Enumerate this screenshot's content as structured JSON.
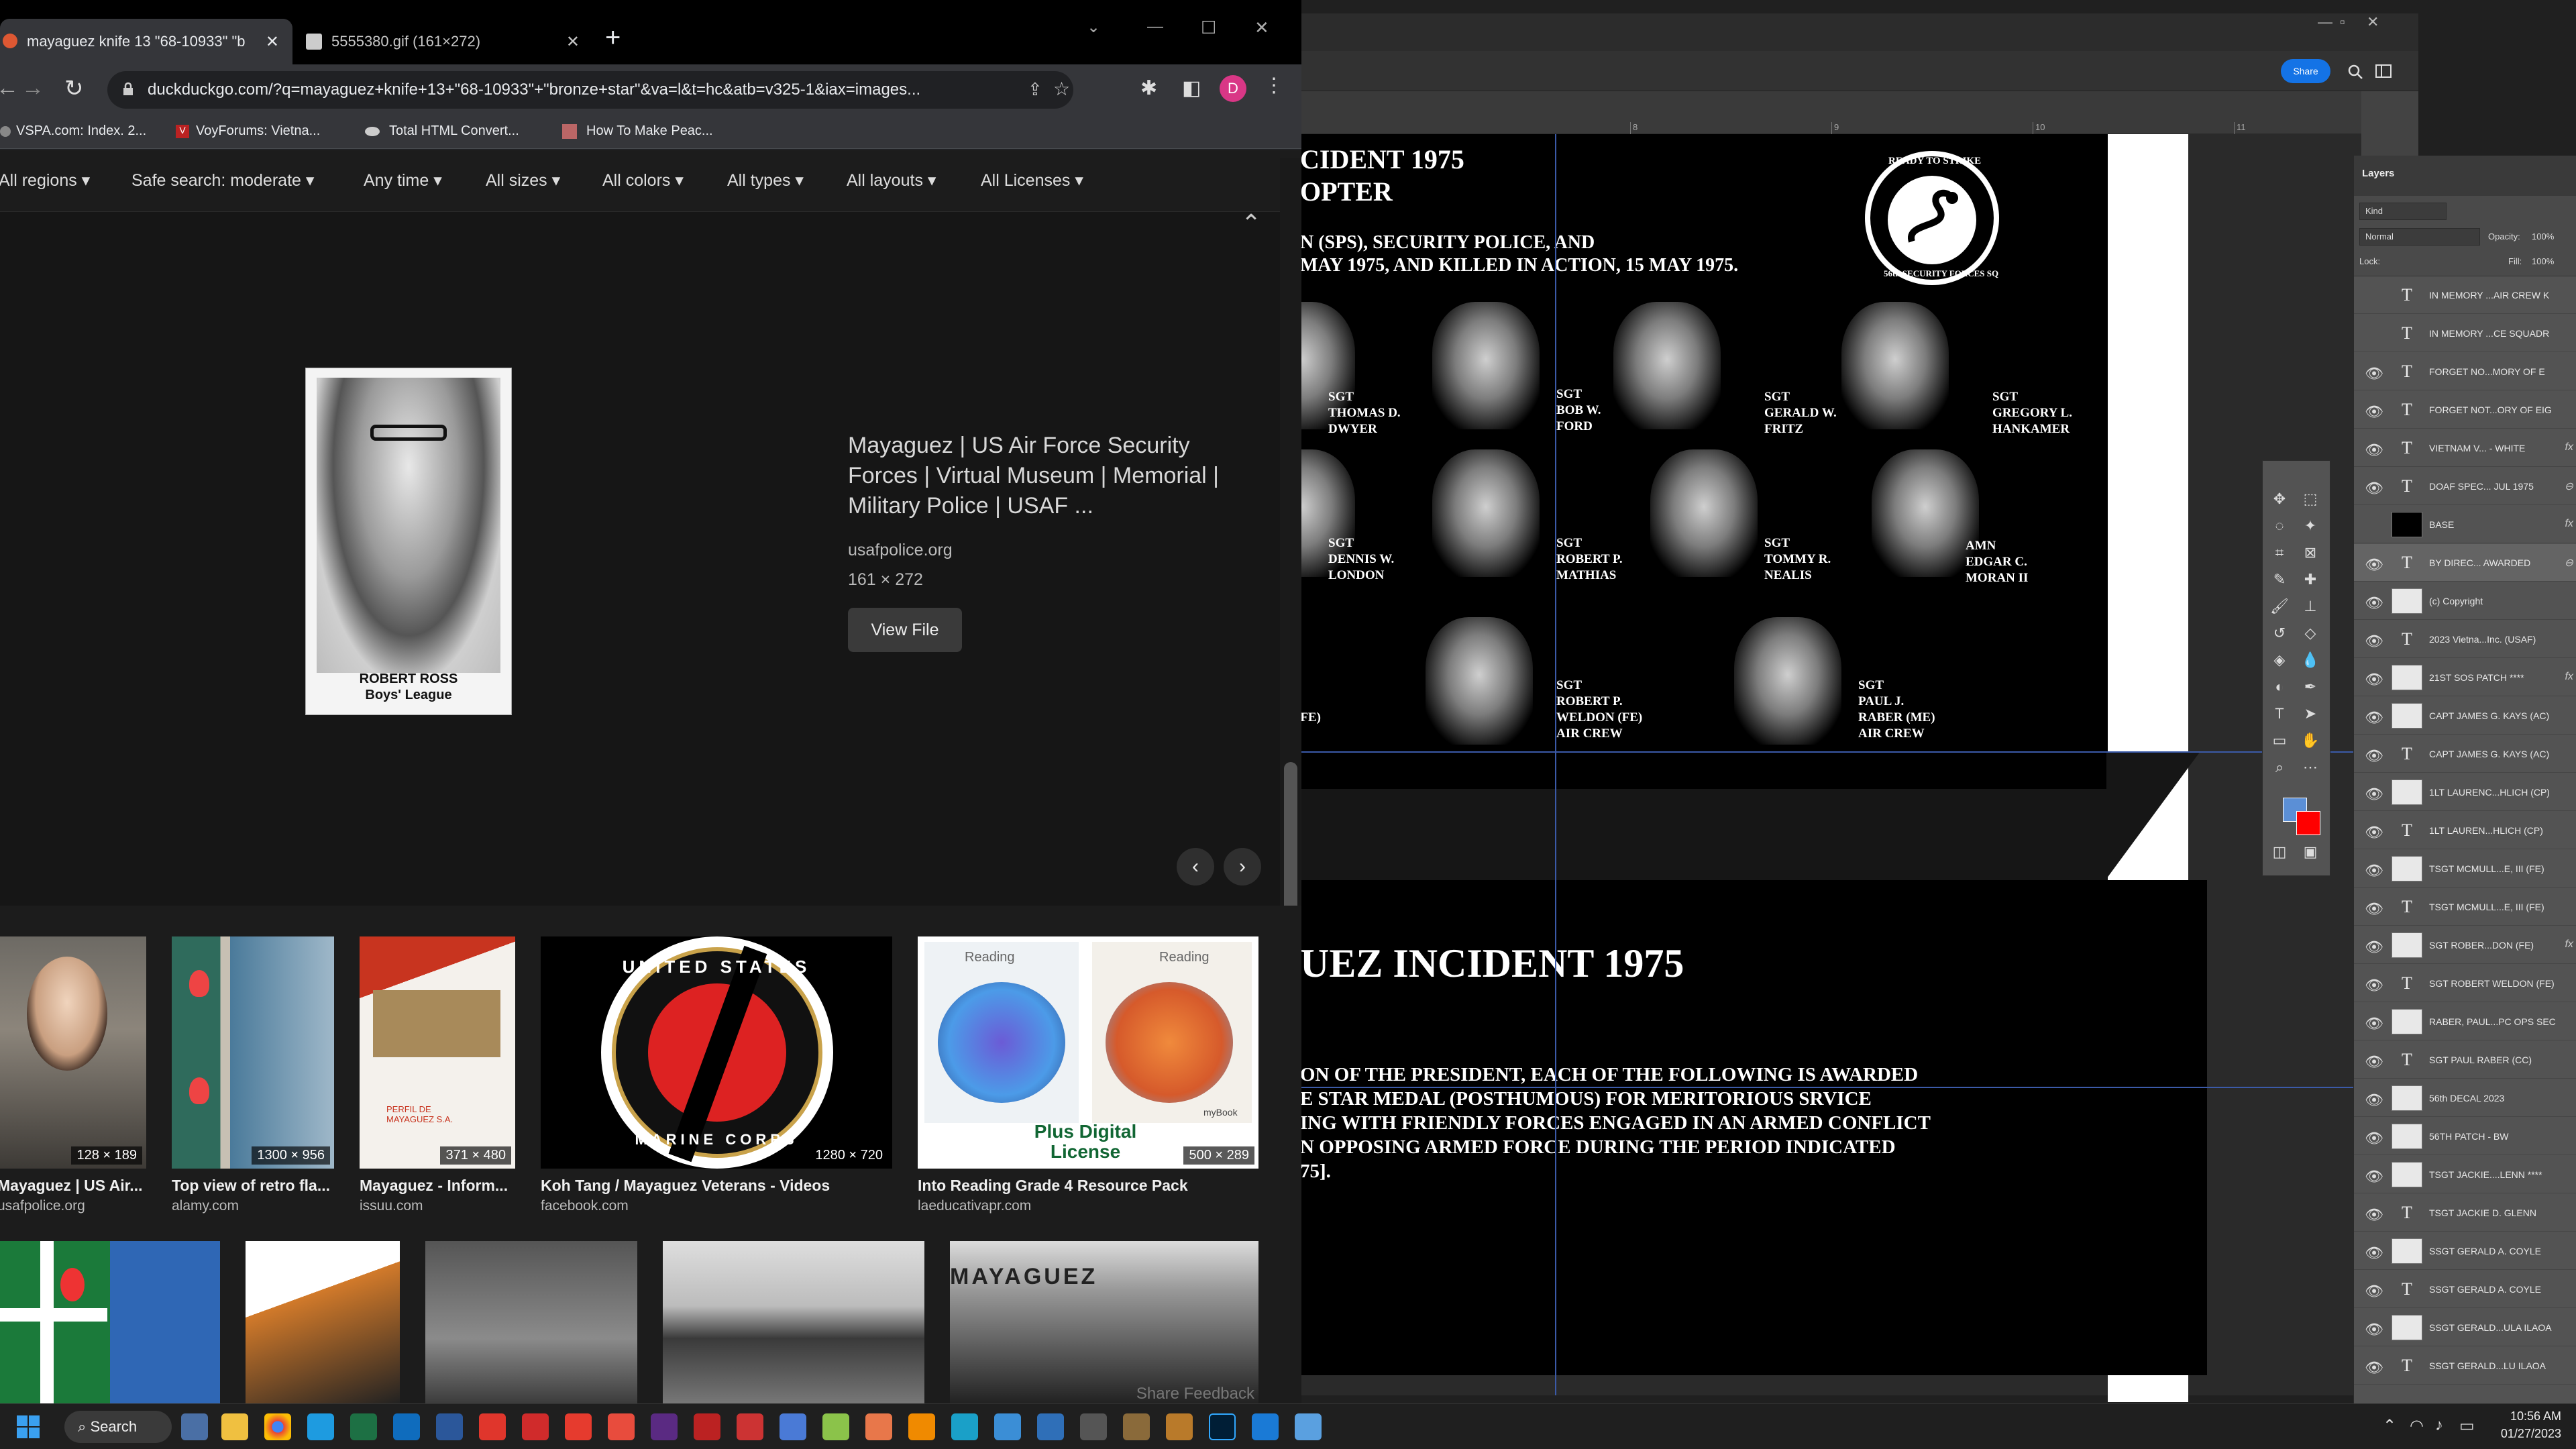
{
  "chrome": {
    "tabs": [
      {
        "label": "mayaguez knife 13 \"68-10933\" \"b",
        "active": true
      },
      {
        "label": "5555380.gif (161×272)",
        "active": false
      }
    ],
    "new_tab": "+",
    "address": "duckduckgo.com/?q=mayaguez+knife+13+\"68-10933\"+\"bronze+star\"&va=l&t=hc&atb=v325-1&iax=images...",
    "profile_initial": "D",
    "bookmarks": [
      "VSPA.com: Index. 2...",
      "VoyForums: Vietna...",
      "Total HTML Convert...",
      "How To Make Peac..."
    ]
  },
  "ddg": {
    "filters": [
      "All regions",
      "Safe search: moderate",
      "Any time",
      "All sizes",
      "All colors",
      "All types",
      "All layouts",
      "All Licenses"
    ],
    "preview": {
      "title": "Mayaguez | US Air Force Security Forces | Virtual Museum | Memorial | Military Police | USAF ...",
      "domain": "usafpolice.org",
      "dimensions": "161 × 272",
      "button": "View File",
      "photo_caption_1": "ROBERT ROSS",
      "photo_caption_2": "Boys' League"
    },
    "results": [
      {
        "title": "Mayaguez | US Air...",
        "domain": "usafpolice.org",
        "dim": "128 × 189"
      },
      {
        "title": "Top view of retro fla...",
        "domain": "alamy.com",
        "dim": "1300 × 956"
      },
      {
        "title": "Mayaguez - Inform...",
        "domain": "issuu.com",
        "dim": "371 × 480"
      },
      {
        "title": "Koh Tang / Mayaguez Veterans - Videos",
        "domain": "facebook.com",
        "dim": "1280 × 720"
      },
      {
        "title": "Into Reading Grade 4 Resource Pack",
        "domain": "laeducativapr.com",
        "dim": "500 × 289"
      }
    ],
    "img_text": {
      "marine_top": "UNITED STATES",
      "marine_bottom": "MARINE CORPS",
      "reading_1": "Reading",
      "reading_2": "Reading",
      "mybook": "myBook",
      "license": "Plus Digital License",
      "perfil": "PERFIL DE MAYAGUEZ S.A.",
      "mayaguez_sign": "MAYAGUEZ"
    },
    "share_feedback": "Share Feedback"
  },
  "photoshop": {
    "share": "Share",
    "ruler_numbers": [
      "8",
      "9",
      "10",
      "11"
    ],
    "document": {
      "heading1": "CIDENT 1975",
      "heading2": "OPTER",
      "line1": "N (SPS), SECURITY POLICE, AND",
      "line2": "MAY 1975, AND KILLED IN ACTION, 15 MAY 1975.",
      "patch_top": "READY TO STRIKE",
      "patch_bottom": "56th SECURITY FORCES SQ",
      "names": [
        {
          "rank": "SGT",
          "first": "THOMAS D.",
          "last": "DWYER"
        },
        {
          "rank": "SGT",
          "first": "BOB W.",
          "last": "FORD"
        },
        {
          "rank": "SGT",
          "first": "GERALD W.",
          "last": "FRITZ"
        },
        {
          "rank": "SGT",
          "first": "GREGORY L.",
          "last": "HANKAMER"
        },
        {
          "rank": "SGT",
          "first": "DENNIS W.",
          "last": "LONDON"
        },
        {
          "rank": "SGT",
          "first": "ROBERT P.",
          "last": "MATHIAS"
        },
        {
          "rank": "SGT",
          "first": "TOMMY R.",
          "last": "NEALIS"
        },
        {
          "rank": "AMN",
          "first": "EDGAR C.",
          "last": "MORAN II"
        },
        {
          "rank": "SGT",
          "first": "ROBERT P.",
          "last": "WELDON (FE)",
          "extra": "AIR CREW"
        },
        {
          "rank": "SGT",
          "first": "PAUL J.",
          "last": "RABER (ME)",
          "extra": "AIR CREW"
        }
      ],
      "fe_fragment": "(FE)",
      "bottom_heading": "UEZ INCIDENT 1975",
      "bottom_lines": [
        "ON OF THE PRESIDENT, EACH OF THE FOLLOWING IS AWARDED",
        "E STAR MEDAL (POSTHUMOUS) FOR MERITORIOUS SRVICE",
        "ING WITH FRIENDLY FORCES ENGAGED IN AN ARMED CONFLICT",
        "N OPPOSING ARMED FORCE DURING THE PERIOD INDICATED",
        "75]."
      ]
    },
    "layers_panel": {
      "title": "Layers",
      "kind": "Kind",
      "blend": "Normal",
      "opacity_label": "Opacity:",
      "opacity": "100%",
      "lock_label": "Lock:",
      "fill_label": "Fill:",
      "fill": "100%",
      "layers": [
        {
          "name": "IN MEMORY ...AIR CREW K",
          "type": "text",
          "visible": false
        },
        {
          "name": "IN MEMORY ...CE SQUADR",
          "type": "text",
          "visible": false
        },
        {
          "name": "FORGET NO...MORY OF E",
          "type": "text",
          "visible": true
        },
        {
          "name": "FORGET NOT...ORY OF EIG",
          "type": "text",
          "visible": true
        },
        {
          "name": "VIETNAM V... - WHITE",
          "type": "text",
          "visible": true,
          "fx": "fx"
        },
        {
          "name": "DOAF SPEC... JUL 1975",
          "type": "text",
          "visible": true,
          "fx": "⊖"
        },
        {
          "name": "BASE",
          "type": "image",
          "visible": false,
          "fx": "fx"
        },
        {
          "name": "BY DIREC... AWARDED",
          "type": "text",
          "visible": true,
          "fx": "⊖"
        },
        {
          "name": "(c) Copyright",
          "type": "image",
          "visible": true
        },
        {
          "name": "2023 Vietna...Inc. (USAF)",
          "type": "text",
          "visible": true
        },
        {
          "name": "21ST SOS PATCH ****",
          "type": "image",
          "visible": true,
          "fx": "fx"
        },
        {
          "name": "CAPT JAMES G. KAYS (AC)",
          "type": "image",
          "visible": true
        },
        {
          "name": "CAPT JAMES G. KAYS (AC)",
          "type": "text",
          "visible": true
        },
        {
          "name": "1LT LAURENC...HLICH (CP)",
          "type": "image",
          "visible": true
        },
        {
          "name": "1LT LAUREN...HLICH (CP)",
          "type": "text",
          "visible": true
        },
        {
          "name": "TSGT MCMULL...E, III (FE)",
          "type": "image",
          "visible": true
        },
        {
          "name": "TSGT MCMULL...E, III (FE)",
          "type": "text",
          "visible": true
        },
        {
          "name": "SGT ROBER...DON (FE)",
          "type": "image",
          "visible": true,
          "fx": "fx"
        },
        {
          "name": "SGT ROBERT WELDON (FE)",
          "type": "text",
          "visible": true
        },
        {
          "name": "RABER, PAUL...PC OPS SEC",
          "type": "image",
          "visible": true
        },
        {
          "name": "SGT PAUL RABER (CC)",
          "type": "text",
          "visible": true
        },
        {
          "name": "56th DECAL 2023",
          "type": "image",
          "visible": true
        },
        {
          "name": "56TH PATCH - BW",
          "type": "image",
          "visible": true
        },
        {
          "name": "TSGT JACKIE....LENN ****",
          "type": "image",
          "visible": true
        },
        {
          "name": "TSGT JACKIE D. GLENN",
          "type": "text",
          "visible": true
        },
        {
          "name": "SSGT GERALD A. COYLE",
          "type": "image",
          "visible": true
        },
        {
          "name": "SSGT GERALD A. COYLE",
          "type": "text",
          "visible": true
        },
        {
          "name": "SSGT GERALD...ULA ILAOA",
          "type": "image",
          "visible": true
        },
        {
          "name": "SSGT GERALD...LU ILAOA",
          "type": "text",
          "visible": true
        }
      ]
    }
  },
  "taskbar": {
    "search": "Search",
    "time": "10:56 AM",
    "date": "01/27/2023"
  },
  "colors": {
    "chrome_frame": "#000000",
    "chrome_toolbar": "#35363a",
    "ddg_bg": "#161616",
    "ps_blue": "#1473e6",
    "guide": "#3b5aa8",
    "profile": "#d93786"
  }
}
